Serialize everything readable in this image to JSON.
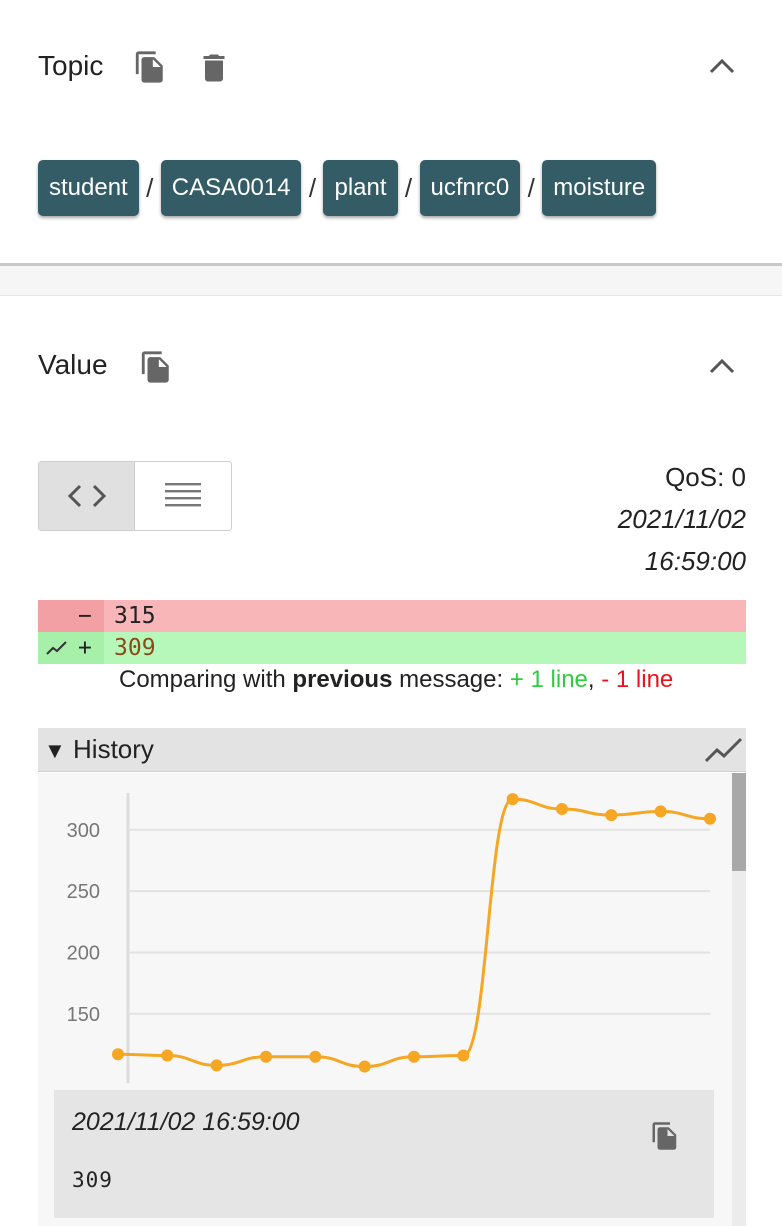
{
  "topic": {
    "title": "Topic",
    "segments": [
      "student",
      "CASA0014",
      "plant",
      "ucfnrc0",
      "moisture"
    ],
    "separator": "/"
  },
  "value": {
    "title": "Value",
    "qos": "QoS: 0",
    "date": "2021/11/02",
    "time": "16:59:00",
    "diff": {
      "removed_sign": "−",
      "removed_value": "315",
      "added_sign": "+",
      "added_value": "309"
    },
    "compare": {
      "prefix": "Comparing with ",
      "bold": "previous",
      "suffix": " message: ",
      "added": "+ 1 line",
      "comma": ",",
      "removed": "- 1 line"
    }
  },
  "history": {
    "title": "History",
    "arrow": "▼",
    "tooltip_date": "2021/11/02 16:59:00",
    "tooltip_value": "309"
  },
  "colors": {
    "chip": "#335c67",
    "line": "#f5a623"
  },
  "chart_data": {
    "type": "line",
    "y_ticks": [
      150,
      200,
      250,
      300
    ],
    "ylim": [
      105,
      330
    ],
    "values": [
      117,
      116,
      108,
      115,
      115,
      107,
      115,
      116,
      325,
      317,
      312,
      315,
      309
    ],
    "grid": true
  }
}
